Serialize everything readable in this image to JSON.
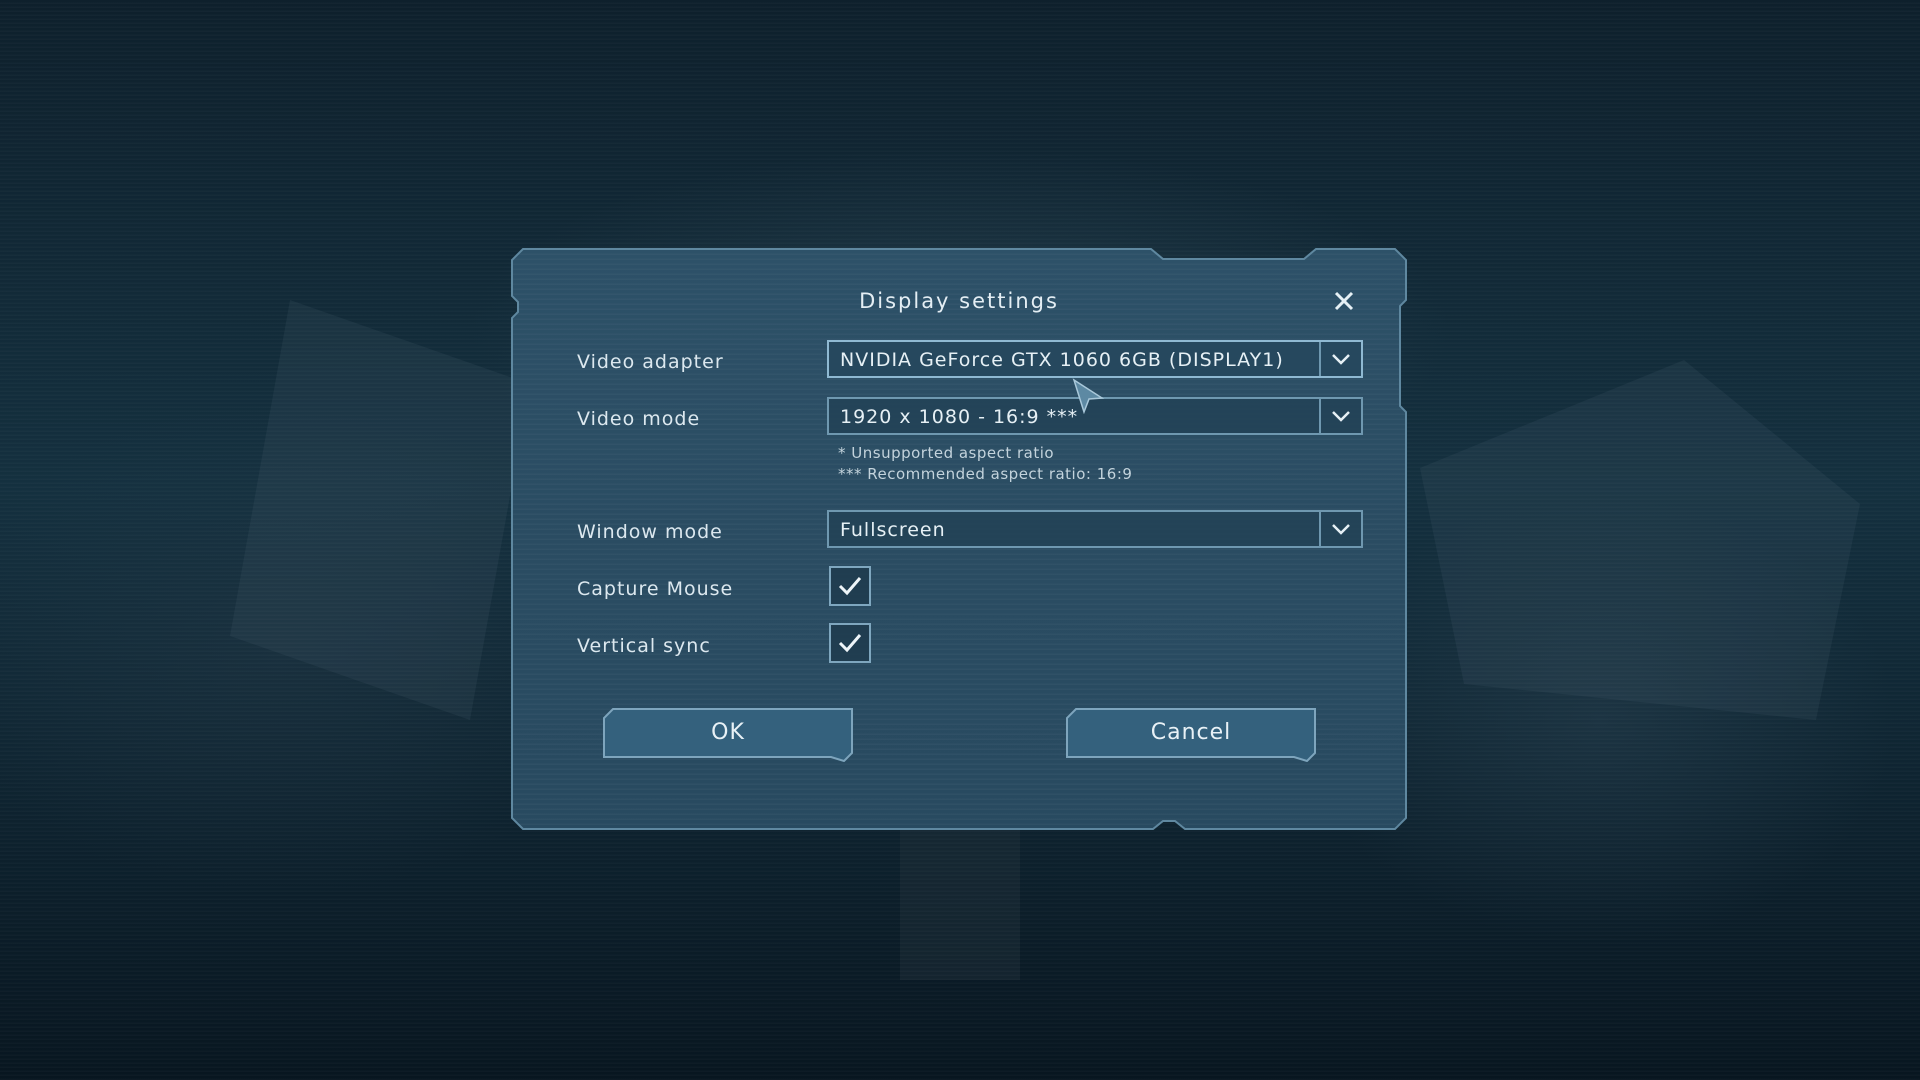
{
  "dialog": {
    "title": "Display settings",
    "close_icon": "close-icon"
  },
  "settings": {
    "video_adapter": {
      "label": "Video adapter",
      "value": "NVIDIA GeForce GTX 1060 6GB (DISPLAY1)"
    },
    "video_mode": {
      "label": "Video mode",
      "value": "1920 x 1080 - 16:9 ***",
      "note_unsupported": "* Unsupported aspect ratio",
      "note_recommended": "*** Recommended aspect ratio: 16:9"
    },
    "window_mode": {
      "label": "Window mode",
      "value": "Fullscreen"
    },
    "capture_mouse": {
      "label": "Capture Mouse",
      "checked": true
    },
    "vertical_sync": {
      "label": "Vertical sync",
      "checked": true
    }
  },
  "buttons": {
    "ok_label": "OK",
    "cancel_label": "Cancel"
  },
  "colors": {
    "panel": "#2a4c62",
    "border": "#6f98b0",
    "text": "#dce8ef",
    "background": "#0b1a24"
  }
}
